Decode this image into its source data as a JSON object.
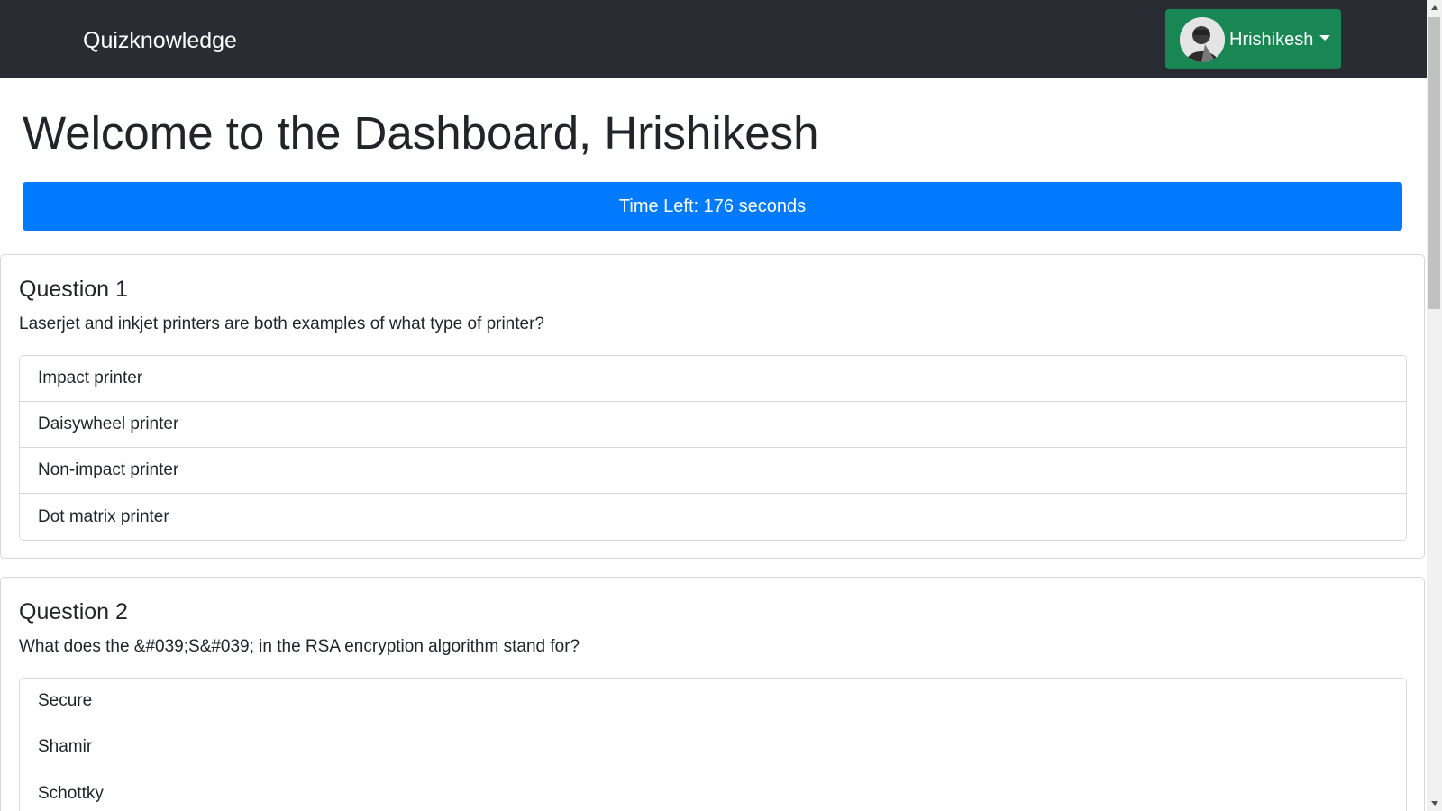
{
  "navbar": {
    "brand": "Quizknowledge",
    "user": {
      "name": "Hrishikesh",
      "avatar_icon": "user-avatar-photo"
    }
  },
  "dashboard": {
    "title": "Welcome to the Dashboard, Hrishikesh",
    "timer_text": "Time Left: 176 seconds"
  },
  "questions": [
    {
      "title": "Question 1",
      "text": "Laserjet and inkjet printers are both examples of what type of printer?",
      "options": [
        "Impact printer",
        "Daisywheel printer",
        "Non-impact printer",
        "Dot matrix printer"
      ]
    },
    {
      "title": "Question 2",
      "text": "What does the &#039;S&#039; in the RSA encryption algorithm stand for?",
      "options": [
        "Secure",
        "Shamir",
        "Schottky"
      ]
    }
  ],
  "colors": {
    "navbar_bg": "#292d33",
    "user_button_bg": "#198754",
    "timer_bg": "#007bff",
    "border": "#d6d9dc"
  }
}
